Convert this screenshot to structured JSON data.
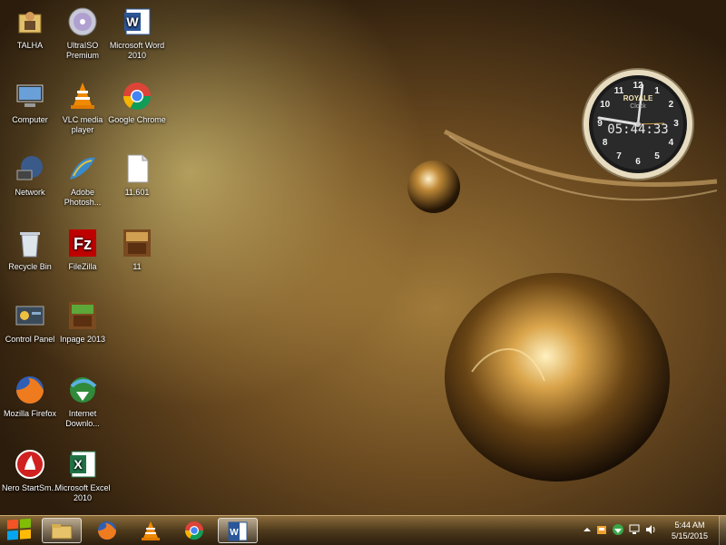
{
  "desktop": {
    "icons": [
      {
        "label": "TALHA",
        "icon": "user-folder-icon"
      },
      {
        "label": "UltraISO Premium",
        "icon": "disc-icon"
      },
      {
        "label": "Microsoft Word 2010",
        "icon": "word-icon"
      },
      {
        "label": "Computer",
        "icon": "computer-icon"
      },
      {
        "label": "VLC media player",
        "icon": "vlc-icon"
      },
      {
        "label": "Google Chrome",
        "icon": "chrome-icon"
      },
      {
        "label": "Network",
        "icon": "network-icon"
      },
      {
        "label": "Adobe Photosh...",
        "icon": "photoshop-icon"
      },
      {
        "label": "11.601",
        "icon": "document-icon"
      },
      {
        "label": "Recycle Bin",
        "icon": "recycle-bin-icon"
      },
      {
        "label": "FileZilla",
        "icon": "filezilla-icon"
      },
      {
        "label": "11",
        "icon": "inpage-shortcut-icon"
      },
      {
        "label": "Control Panel",
        "icon": "control-panel-icon"
      },
      {
        "label": "Inpage 2013",
        "icon": "inpage-icon"
      },
      {
        "label": "Mozilla Firefox",
        "icon": "firefox-icon"
      },
      {
        "label": "Internet Downlo...",
        "icon": "idm-icon"
      },
      {
        "label": "Nero StartSm...",
        "icon": "nero-icon"
      },
      {
        "label": "Microsoft Excel 2010",
        "icon": "excel-icon"
      }
    ]
  },
  "clock_gadget": {
    "brand": "ROYALE",
    "subtitle": "Clock",
    "time": "05:44:33",
    "numerals": [
      "12",
      "1",
      "2",
      "3",
      "4",
      "5",
      "6",
      "7",
      "8",
      "9",
      "10",
      "11"
    ]
  },
  "taskbar": {
    "pinned": [
      {
        "name": "windows-explorer",
        "icon": "explorer-icon"
      },
      {
        "name": "firefox",
        "icon": "firefox-icon"
      },
      {
        "name": "vlc",
        "icon": "vlc-icon"
      },
      {
        "name": "chrome",
        "icon": "chrome-icon"
      },
      {
        "name": "word",
        "icon": "word-icon"
      }
    ],
    "tray": {
      "time": "5:44 AM",
      "date": "5/15/2015"
    }
  },
  "colors": {
    "taskbar": "#4e3a1c",
    "wallpaper_gold": "#c8a060",
    "text": "#ffffff"
  }
}
